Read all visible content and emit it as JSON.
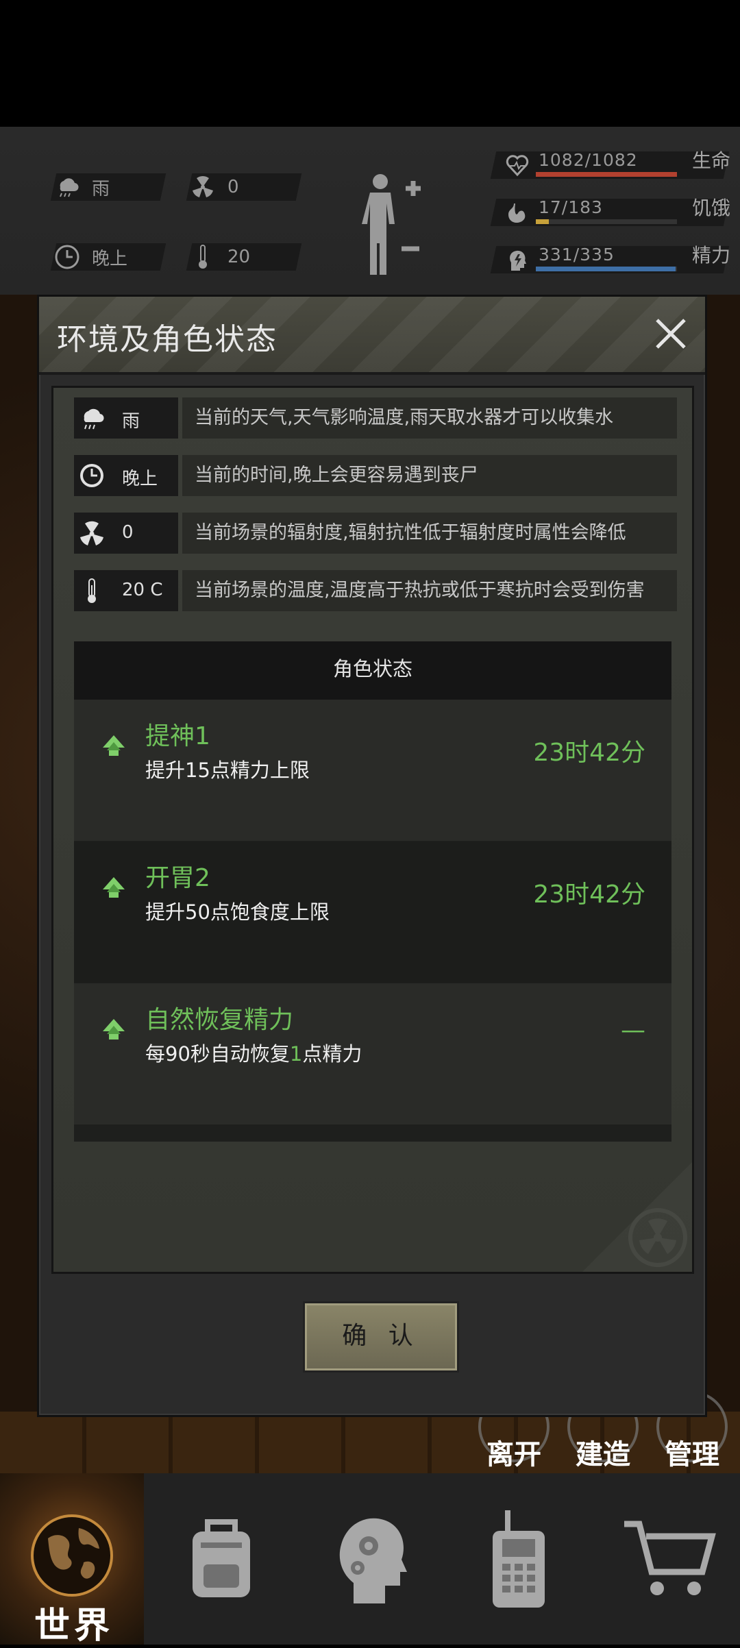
{
  "hud": {
    "weather": "雨",
    "radiation": "0",
    "time_of_day": "晚上",
    "temperature": "20",
    "stats": [
      {
        "value": "1082/1082",
        "label": "生命",
        "fill": 1.0,
        "color": "#b2412f",
        "icon": "heart-pulse-icon"
      },
      {
        "value": "17/183",
        "label": "饥饿",
        "fill": 0.093,
        "color": "#c7a13a",
        "icon": "stomach-icon"
      },
      {
        "value": "331/335",
        "label": "精力",
        "fill": 0.988,
        "color": "#3e6fa6",
        "icon": "energy-head-icon"
      }
    ]
  },
  "modal": {
    "title": "环境及角色状态",
    "env": [
      {
        "icon": "rain-cloud-icon",
        "value": "雨",
        "desc": "当前的天气,天气影响温度,雨天取水器才可以收集水"
      },
      {
        "icon": "clock-icon",
        "value": "晚上",
        "desc": "当前的时间,晚上会更容易遇到丧尸"
      },
      {
        "icon": "radiation-icon",
        "value": "0",
        "desc": "当前场景的辐射度,辐射抗性低于辐射度时属性会降低"
      },
      {
        "icon": "thermometer-icon",
        "value": "20 C",
        "desc": "当前场景的温度,温度高于热抗或低于寒抗时会受到伤害"
      }
    ],
    "status_title": "角色状态",
    "status_items": [
      {
        "name": "提神1",
        "desc_pre": "提升15点精力上限",
        "desc_hl": "",
        "desc_post": "",
        "time": "23时42分"
      },
      {
        "name": "开胃2",
        "desc_pre": "提升50点饱食度上限",
        "desc_hl": "",
        "desc_post": "",
        "time": "23时42分"
      },
      {
        "name": "自然恢复精力",
        "desc_pre": "每90秒自动恢复",
        "desc_hl": "1",
        "desc_post": "点精力",
        "time": "—"
      }
    ],
    "confirm_label": "确 认"
  },
  "side_actions": [
    "离开",
    "建造",
    "管理"
  ],
  "nav": {
    "world_label": "世界",
    "items": [
      "globe-icon",
      "backpack-icon",
      "head-gear-icon",
      "walkie-talkie-icon",
      "shopping-cart-icon"
    ]
  }
}
